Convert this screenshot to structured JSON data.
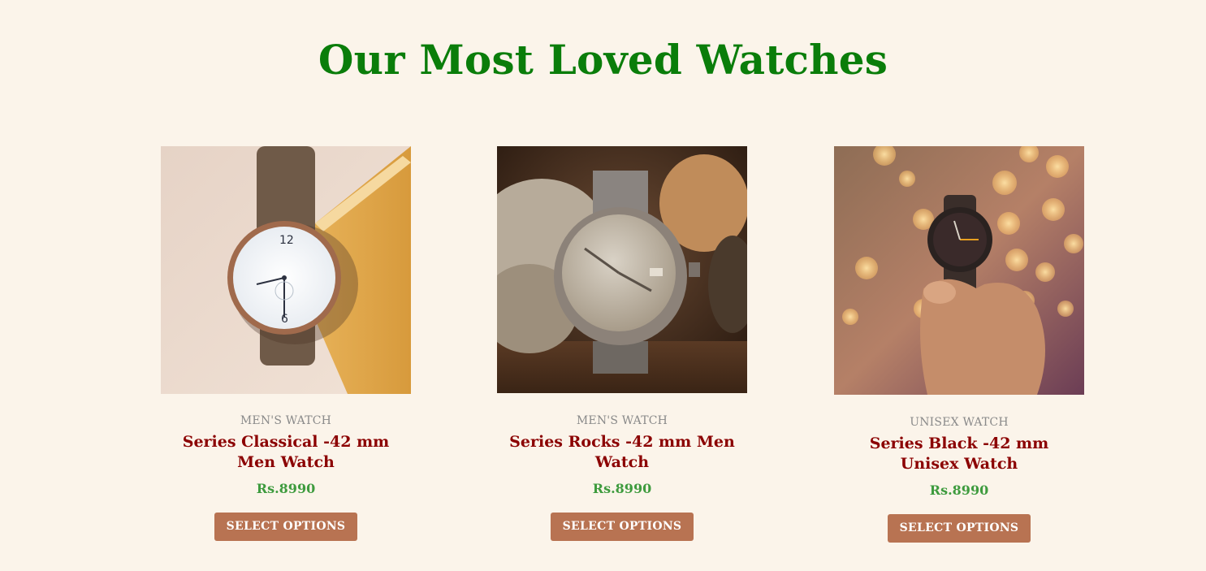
{
  "page": {
    "title": "Our Most Loved Watches"
  },
  "colors": {
    "background": "#fbf4ea",
    "title": "#0a7d0a",
    "product_name": "#8b0000",
    "price": "#3e9b3e",
    "category": "#8a8a8a",
    "button": "#b87352"
  },
  "products": [
    {
      "image": "brown-leather-watch-photo",
      "category": "MEN'S WATCH",
      "name": "Series Classical -42 mm Men Watch",
      "price": "Rs.8990",
      "button_label": "SELECT OPTIONS"
    },
    {
      "image": "vintage-steel-watch-photo",
      "category": "MEN'S WATCH",
      "name": "Series Rocks -42 mm Men Watch",
      "price": "Rs.8990",
      "button_label": "SELECT OPTIONS"
    },
    {
      "image": "black-watch-in-hand-photo",
      "category": "UNISEX WATCH",
      "name": "Series Black -42 mm Unisex Watch",
      "price": "Rs.8990",
      "button_label": "SELECT OPTIONS"
    }
  ]
}
